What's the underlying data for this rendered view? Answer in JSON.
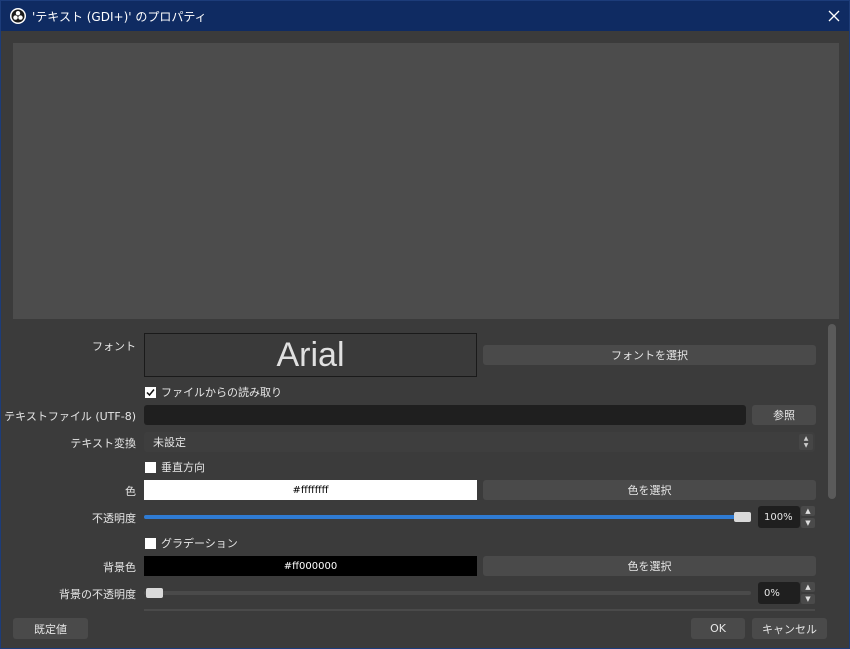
{
  "window": {
    "title": "'テキスト (GDI+)' のプロパティ"
  },
  "properties": {
    "font": {
      "label": "フォント",
      "preview": "Arial",
      "select_button": "フォントを選択"
    },
    "read_from_file": {
      "label": "ファイルからの読み取り",
      "checked": true
    },
    "text_file": {
      "label": "テキストファイル (UTF-8)",
      "value": "",
      "browse_button": "参照"
    },
    "text_transform": {
      "label": "テキスト変換",
      "value": "未設定"
    },
    "vertical": {
      "label": "垂直方向",
      "checked": false
    },
    "color": {
      "label": "色",
      "value": "#ffffffff",
      "select_button": "色を選択"
    },
    "opacity": {
      "label": "不透明度",
      "value_text": "100%",
      "value": 100
    },
    "gradient": {
      "label": "グラデーション",
      "checked": false
    },
    "bg_color": {
      "label": "背景色",
      "value": "#ff000000",
      "select_button": "色を選択"
    },
    "bg_opacity": {
      "label": "背景の不透明度",
      "value_text": "0%",
      "value": 0
    }
  },
  "footer": {
    "defaults_button": "既定値",
    "ok_button": "OK",
    "cancel_button": "キャンセル"
  },
  "colors": {
    "titlebar": "#0f2b62",
    "accent": "#2f7bd3"
  }
}
